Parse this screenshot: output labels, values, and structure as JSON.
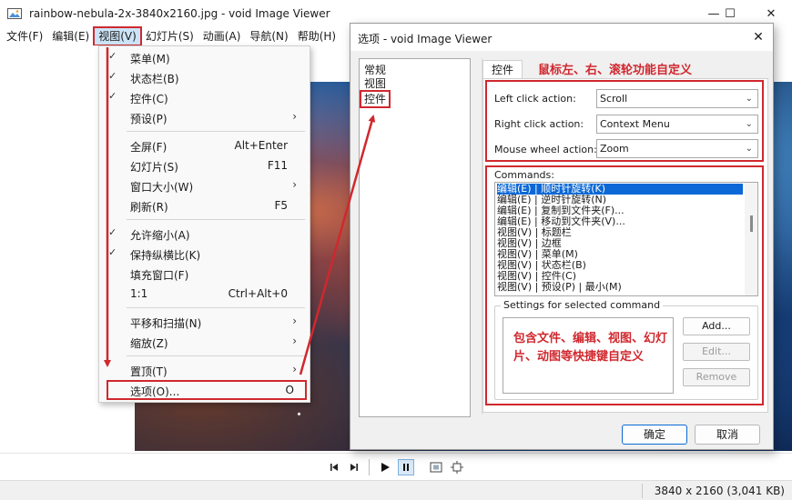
{
  "window": {
    "title": "rainbow-nebula-2x-3840x2160.jpg - void Image Viewer",
    "minimize": "—",
    "maximize": "☐",
    "close": "✕"
  },
  "menubar": [
    "文件(F)",
    "编辑(E)",
    "视图(V)",
    "幻灯片(S)",
    "动画(A)",
    "导航(N)",
    "帮助(H)"
  ],
  "view_menu": {
    "items": [
      {
        "label": "菜单(M)",
        "checked": true
      },
      {
        "label": "状态栏(B)",
        "checked": true
      },
      {
        "label": "控件(C)",
        "checked": true
      },
      {
        "label": "预设(P)",
        "submenu": true
      },
      {
        "label": "全屏(F)",
        "shortcut": "Alt+Enter"
      },
      {
        "label": "幻灯片(S)",
        "shortcut": "F11"
      },
      {
        "label": "窗口大小(W)",
        "submenu": true
      },
      {
        "label": "刷新(R)",
        "shortcut": "F5"
      },
      {
        "label": "允许缩小(A)",
        "checked": true
      },
      {
        "label": "保持纵横比(K)",
        "checked": true
      },
      {
        "label": "填充窗口(F)"
      },
      {
        "label": "1:1",
        "shortcut": "Ctrl+Alt+0"
      },
      {
        "label": "平移和扫描(N)",
        "submenu": true
      },
      {
        "label": "缩放(Z)",
        "submenu": true
      },
      {
        "label": "置顶(T)",
        "submenu": true
      },
      {
        "label": "选项(O)...",
        "shortcut": "O"
      }
    ]
  },
  "dialog": {
    "title": "选项 - void Image Viewer",
    "close": "✕",
    "nav": [
      "常规",
      "视图",
      "控件"
    ],
    "tab": "控件",
    "mouse_note": "鼠标左、右、滚轮功能自定义",
    "left_click_label": "Left click action:",
    "left_click_value": "Scroll",
    "right_click_label": "Right click action:",
    "right_click_value": "Context Menu",
    "wheel_label": "Mouse wheel action:",
    "wheel_value": "Zoom",
    "commands_label": "Commands:",
    "commands": [
      "编辑(E) | 顺时针旋转(K)",
      "编辑(E) | 逆时针旋转(N)",
      "编辑(E) | 复制到文件夹(F)...",
      "编辑(E) | 移动到文件夹(V)...",
      "视图(V) | 标题栏",
      "视图(V) | 边框",
      "视图(V) | 菜单(M)",
      "视图(V) | 状态栏(B)",
      "视图(V) | 控件(C)",
      "视图(V) | 预设(P) | 最小(M)"
    ],
    "settings_legend": "Settings for selected command",
    "keys_note": "包含文件、编辑、视图、幻灯片、动图等快捷键自定义",
    "add": "Add...",
    "edit": "Edit...",
    "remove": "Remove",
    "ok": "确定",
    "cancel": "取消"
  },
  "status": {
    "size": "3840 x 2160 (3,041 KB)"
  },
  "colors": {
    "annotation_red": "#d0282e",
    "selection_blue": "#0b68d6"
  }
}
